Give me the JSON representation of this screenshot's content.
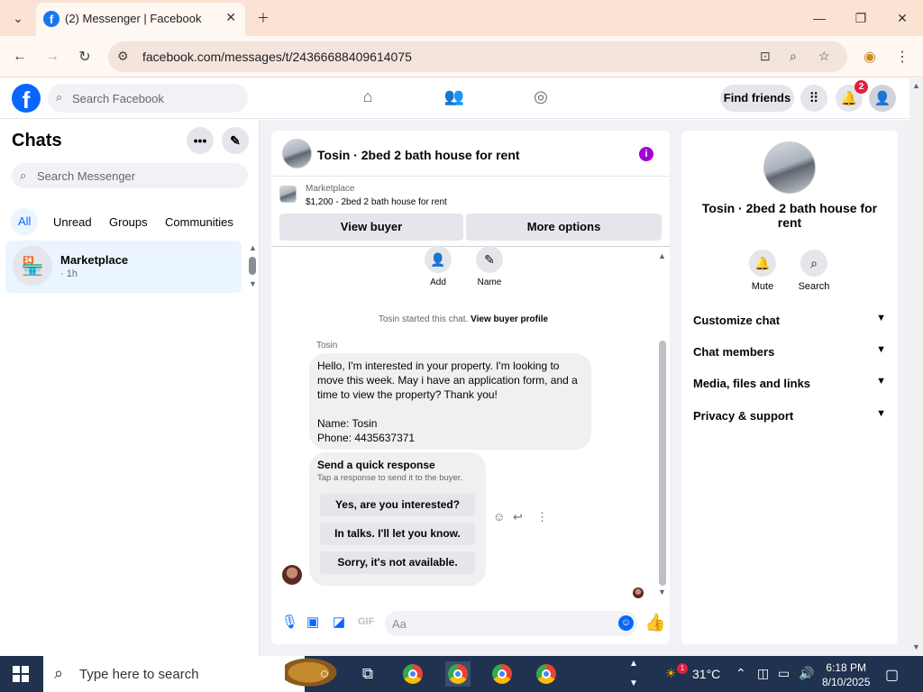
{
  "browser": {
    "tab_title": "(2) Messenger | Facebook",
    "url": "facebook.com/messages/t/24366688409614075"
  },
  "facebook_header": {
    "search_placeholder": "Search Facebook",
    "find_friends_label": "Find friends",
    "notifications_count": "2"
  },
  "chats_panel": {
    "title": "Chats",
    "search_placeholder": "Search Messenger",
    "filters": [
      "All",
      "Unread",
      "Groups",
      "Communities"
    ],
    "selected_filter": "All",
    "items": [
      {
        "name": "Marketplace",
        "time": "· 1h"
      }
    ]
  },
  "conversation": {
    "title": "Tosin · 2bed 2 bath house for rent",
    "marketplace_label": "Marketplace",
    "listing": "$1,200 - 2bed 2 bath house for rent",
    "view_buyer_label": "View buyer",
    "more_options_label": "More options",
    "actions": [
      {
        "icon": "add-person-icon",
        "label": "Add"
      },
      {
        "icon": "pencil-icon",
        "label": "Name"
      }
    ],
    "started_text": "Tosin started this chat.",
    "view_profile_link": "View buyer profile",
    "sender_name": "Tosin",
    "message": "Hello, I'm interested in your property. I'm looking to move this week. May i have an application form, and a time to view the property? Thank you!\n\nName: Tosin\nPhone: 4435637371",
    "quick_response": {
      "title": "Send a quick response",
      "subtitle": "Tap a response to send it to the buyer.",
      "options": [
        "Yes, are you interested?",
        "In talks. I'll let you know.",
        "Sorry, it's not available."
      ]
    },
    "composer_placeholder": "Aa"
  },
  "details_panel": {
    "title": "Tosin · 2bed 2 bath house for rent",
    "actions": [
      {
        "icon": "bell-icon",
        "label": "Mute"
      },
      {
        "icon": "search-icon",
        "label": "Search"
      }
    ],
    "sections": [
      "Customize chat",
      "Chat members",
      "Media, files and links",
      "Privacy & support"
    ]
  },
  "taskbar": {
    "search_placeholder": "Type here to search",
    "temperature": "31°C",
    "weather_badge": "1",
    "time": "6:18 PM",
    "date": "8/10/2025"
  },
  "colors": {
    "facebook_blue": "#0866ff",
    "info_purple": "#a400d6",
    "notification_red": "#e41e3f",
    "chrome_frame": "#fbe3d3"
  }
}
